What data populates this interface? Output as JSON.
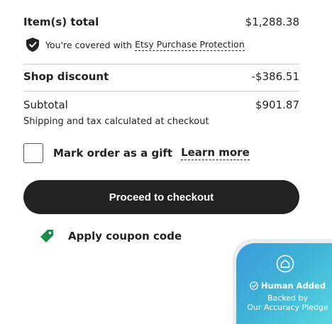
{
  "summary": {
    "items_total_label": "Item(s) total",
    "items_total_value": "$1,288.38",
    "protection_prefix": "You're covered with",
    "protection_link": "Etsy Purchase Protection",
    "shop_discount_label": "Shop discount",
    "shop_discount_value": "-$386.51",
    "subtotal_label": "Subtotal",
    "subtotal_value": "$901.87",
    "shipping_note": "Shipping and tax calculated at checkout"
  },
  "gift": {
    "label": "Mark order as a gift",
    "learn_more": "Learn more",
    "checked": false
  },
  "checkout_button": "Proceed to checkout",
  "coupon_label": "Apply coupon code",
  "pledge_badge": {
    "title": "Human Added",
    "line1": "Backed by",
    "line2": "Our Accuracy Pledge"
  },
  "colors": {
    "button": "#222222",
    "coupon_tag": "#1e8a4c",
    "badge_gradient_start": "#3a9ad9",
    "badge_gradient_end": "#58d8e0"
  },
  "icons": [
    "shield-check-icon",
    "tag-icon",
    "house-icon",
    "check-circle-icon"
  ]
}
